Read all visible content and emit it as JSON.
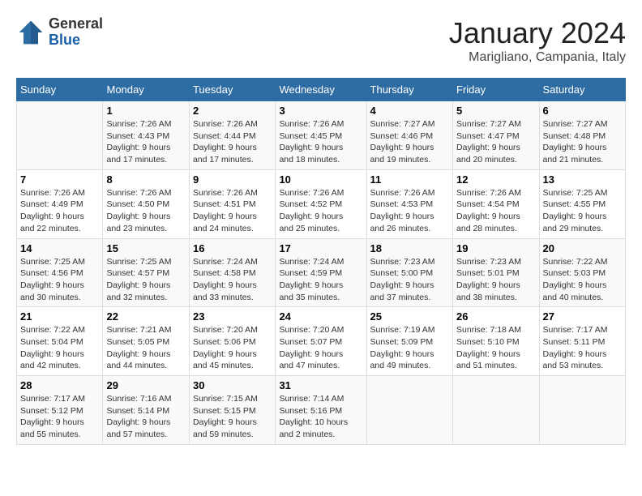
{
  "header": {
    "logo": {
      "general": "General",
      "blue": "Blue"
    },
    "title": "January 2024",
    "subtitle": "Marigliano, Campania, Italy"
  },
  "columns": [
    "Sunday",
    "Monday",
    "Tuesday",
    "Wednesday",
    "Thursday",
    "Friday",
    "Saturday"
  ],
  "weeks": [
    [
      {
        "date": "",
        "info": ""
      },
      {
        "date": "1",
        "info": "Sunrise: 7:26 AM\nSunset: 4:43 PM\nDaylight: 9 hours\nand 17 minutes."
      },
      {
        "date": "2",
        "info": "Sunrise: 7:26 AM\nSunset: 4:44 PM\nDaylight: 9 hours\nand 17 minutes."
      },
      {
        "date": "3",
        "info": "Sunrise: 7:26 AM\nSunset: 4:45 PM\nDaylight: 9 hours\nand 18 minutes."
      },
      {
        "date": "4",
        "info": "Sunrise: 7:27 AM\nSunset: 4:46 PM\nDaylight: 9 hours\nand 19 minutes."
      },
      {
        "date": "5",
        "info": "Sunrise: 7:27 AM\nSunset: 4:47 PM\nDaylight: 9 hours\nand 20 minutes."
      },
      {
        "date": "6",
        "info": "Sunrise: 7:27 AM\nSunset: 4:48 PM\nDaylight: 9 hours\nand 21 minutes."
      }
    ],
    [
      {
        "date": "7",
        "info": "Sunrise: 7:26 AM\nSunset: 4:49 PM\nDaylight: 9 hours\nand 22 minutes."
      },
      {
        "date": "8",
        "info": "Sunrise: 7:26 AM\nSunset: 4:50 PM\nDaylight: 9 hours\nand 23 minutes."
      },
      {
        "date": "9",
        "info": "Sunrise: 7:26 AM\nSunset: 4:51 PM\nDaylight: 9 hours\nand 24 minutes."
      },
      {
        "date": "10",
        "info": "Sunrise: 7:26 AM\nSunset: 4:52 PM\nDaylight: 9 hours\nand 25 minutes."
      },
      {
        "date": "11",
        "info": "Sunrise: 7:26 AM\nSunset: 4:53 PM\nDaylight: 9 hours\nand 26 minutes."
      },
      {
        "date": "12",
        "info": "Sunrise: 7:26 AM\nSunset: 4:54 PM\nDaylight: 9 hours\nand 28 minutes."
      },
      {
        "date": "13",
        "info": "Sunrise: 7:25 AM\nSunset: 4:55 PM\nDaylight: 9 hours\nand 29 minutes."
      }
    ],
    [
      {
        "date": "14",
        "info": "Sunrise: 7:25 AM\nSunset: 4:56 PM\nDaylight: 9 hours\nand 30 minutes."
      },
      {
        "date": "15",
        "info": "Sunrise: 7:25 AM\nSunset: 4:57 PM\nDaylight: 9 hours\nand 32 minutes."
      },
      {
        "date": "16",
        "info": "Sunrise: 7:24 AM\nSunset: 4:58 PM\nDaylight: 9 hours\nand 33 minutes."
      },
      {
        "date": "17",
        "info": "Sunrise: 7:24 AM\nSunset: 4:59 PM\nDaylight: 9 hours\nand 35 minutes."
      },
      {
        "date": "18",
        "info": "Sunrise: 7:23 AM\nSunset: 5:00 PM\nDaylight: 9 hours\nand 37 minutes."
      },
      {
        "date": "19",
        "info": "Sunrise: 7:23 AM\nSunset: 5:01 PM\nDaylight: 9 hours\nand 38 minutes."
      },
      {
        "date": "20",
        "info": "Sunrise: 7:22 AM\nSunset: 5:03 PM\nDaylight: 9 hours\nand 40 minutes."
      }
    ],
    [
      {
        "date": "21",
        "info": "Sunrise: 7:22 AM\nSunset: 5:04 PM\nDaylight: 9 hours\nand 42 minutes."
      },
      {
        "date": "22",
        "info": "Sunrise: 7:21 AM\nSunset: 5:05 PM\nDaylight: 9 hours\nand 44 minutes."
      },
      {
        "date": "23",
        "info": "Sunrise: 7:20 AM\nSunset: 5:06 PM\nDaylight: 9 hours\nand 45 minutes."
      },
      {
        "date": "24",
        "info": "Sunrise: 7:20 AM\nSunset: 5:07 PM\nDaylight: 9 hours\nand 47 minutes."
      },
      {
        "date": "25",
        "info": "Sunrise: 7:19 AM\nSunset: 5:09 PM\nDaylight: 9 hours\nand 49 minutes."
      },
      {
        "date": "26",
        "info": "Sunrise: 7:18 AM\nSunset: 5:10 PM\nDaylight: 9 hours\nand 51 minutes."
      },
      {
        "date": "27",
        "info": "Sunrise: 7:17 AM\nSunset: 5:11 PM\nDaylight: 9 hours\nand 53 minutes."
      }
    ],
    [
      {
        "date": "28",
        "info": "Sunrise: 7:17 AM\nSunset: 5:12 PM\nDaylight: 9 hours\nand 55 minutes."
      },
      {
        "date": "29",
        "info": "Sunrise: 7:16 AM\nSunset: 5:14 PM\nDaylight: 9 hours\nand 57 minutes."
      },
      {
        "date": "30",
        "info": "Sunrise: 7:15 AM\nSunset: 5:15 PM\nDaylight: 9 hours\nand 59 minutes."
      },
      {
        "date": "31",
        "info": "Sunrise: 7:14 AM\nSunset: 5:16 PM\nDaylight: 10 hours\nand 2 minutes."
      },
      {
        "date": "",
        "info": ""
      },
      {
        "date": "",
        "info": ""
      },
      {
        "date": "",
        "info": ""
      }
    ]
  ]
}
